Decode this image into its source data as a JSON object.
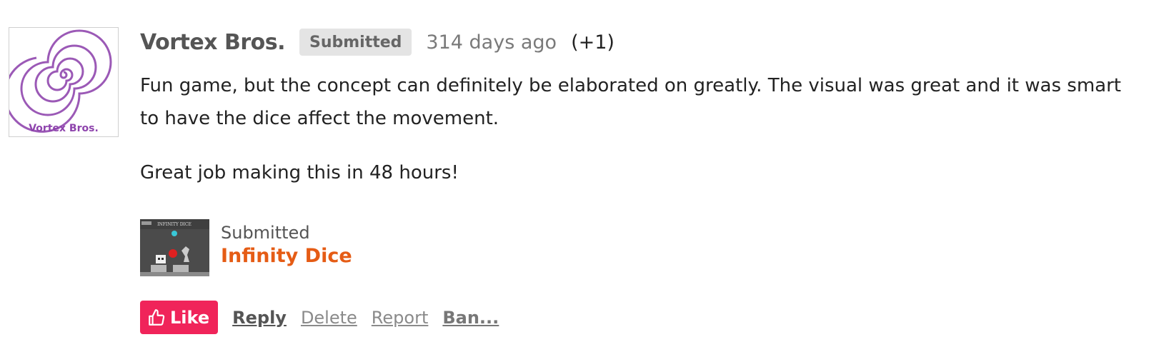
{
  "comment": {
    "author": "Vortex Bros.",
    "author_avatar_caption": "Vortex Bros.",
    "badge": "Submitted",
    "time": "314 days ago",
    "votes": "(+1)",
    "paragraphs": [
      "Fun game, but the concept can definitely be elaborated on greatly. The visual was great and it was smart to have the dice affect the movement.",
      "Great job making this in 48 hours!"
    ]
  },
  "game": {
    "status": "Submitted",
    "title": "Infinity Dice",
    "thumb_caption": "INFINITY DICE"
  },
  "actions": {
    "like": "Like",
    "reply": "Reply",
    "delete": "Delete",
    "report": "Report",
    "ban": "Ban..."
  },
  "colors": {
    "accent_like": "#f0245a",
    "game_title": "#e55c15",
    "avatar_spiral": "#9b59b6"
  },
  "icons": {
    "like_icon": "thumbs-up-icon"
  }
}
